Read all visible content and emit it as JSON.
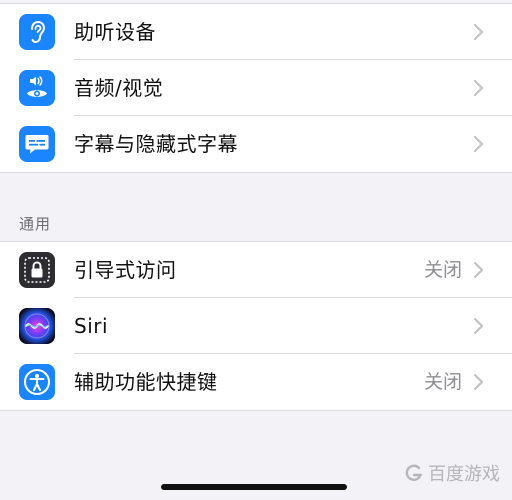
{
  "top_group": {
    "items": [
      {
        "label": "助听设备",
        "icon": "ear-icon",
        "value": ""
      },
      {
        "label": "音频/视觉",
        "icon": "audio-visual-icon",
        "value": ""
      },
      {
        "label": "字幕与隐藏式字幕",
        "icon": "subtitles-icon",
        "value": ""
      }
    ]
  },
  "general_section": {
    "header": "通用",
    "items": [
      {
        "label": "引导式访问",
        "icon": "guided-access-lock-icon",
        "value": "关闭"
      },
      {
        "label": "Siri",
        "icon": "siri-icon",
        "value": ""
      },
      {
        "label": "辅助功能快捷键",
        "icon": "accessibility-icon",
        "value": "关闭"
      }
    ]
  },
  "watermark": {
    "text": "百度游戏"
  },
  "colors": {
    "accent_blue": "#1b84ff",
    "background": "#f2f2f7",
    "secondary_text": "#8e8e93"
  }
}
